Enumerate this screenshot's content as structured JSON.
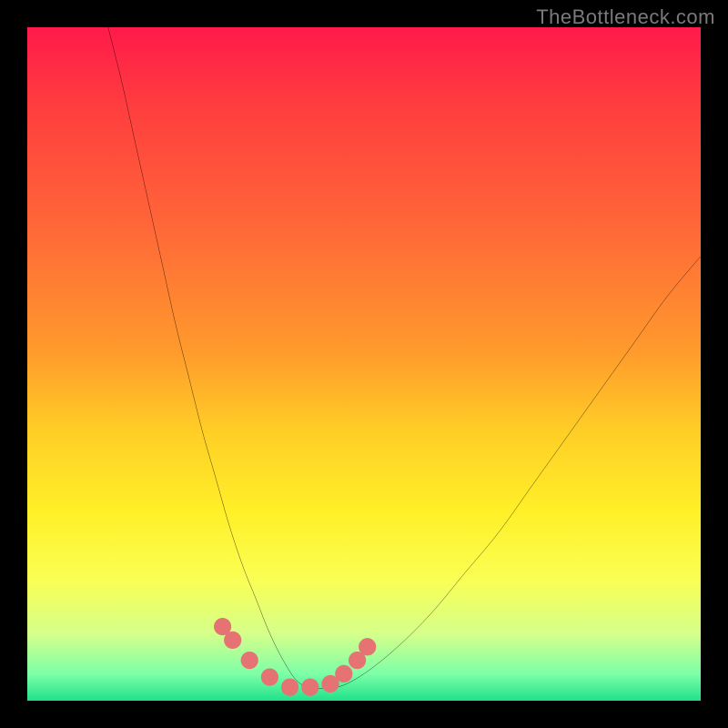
{
  "watermark": "TheBottleneck.com",
  "chart_data": {
    "type": "line",
    "title": "",
    "xlabel": "",
    "ylabel": "",
    "xlim": [
      0,
      100
    ],
    "ylim": [
      0,
      100
    ],
    "series": [
      {
        "name": "bottleneck-curve",
        "x": [
          12,
          14,
          16,
          18,
          20,
          22,
          24,
          26,
          28,
          30,
          32,
          34,
          36,
          38,
          40,
          42,
          46,
          50,
          55,
          60,
          65,
          70,
          75,
          80,
          85,
          90,
          95,
          100
        ],
        "y": [
          100,
          92,
          83,
          74,
          65,
          56,
          48,
          40,
          33,
          26,
          20,
          15,
          10,
          6,
          3,
          2,
          2,
          4,
          8,
          13,
          19,
          25,
          32,
          39,
          46,
          53,
          60,
          66
        ]
      }
    ],
    "highlight_points": {
      "name": "optimal-range-markers",
      "x": [
        29,
        30.5,
        33,
        36,
        39,
        42,
        45,
        47,
        49,
        50.5
      ],
      "y": [
        11,
        9,
        6,
        3.5,
        2,
        2,
        2.5,
        4,
        6,
        8
      ]
    },
    "background_gradient": {
      "top": "#ff1a4a",
      "mid": "#fff028",
      "bottom": "#20e28a"
    },
    "curve_color": "#000000",
    "marker_color": "#e57373"
  }
}
